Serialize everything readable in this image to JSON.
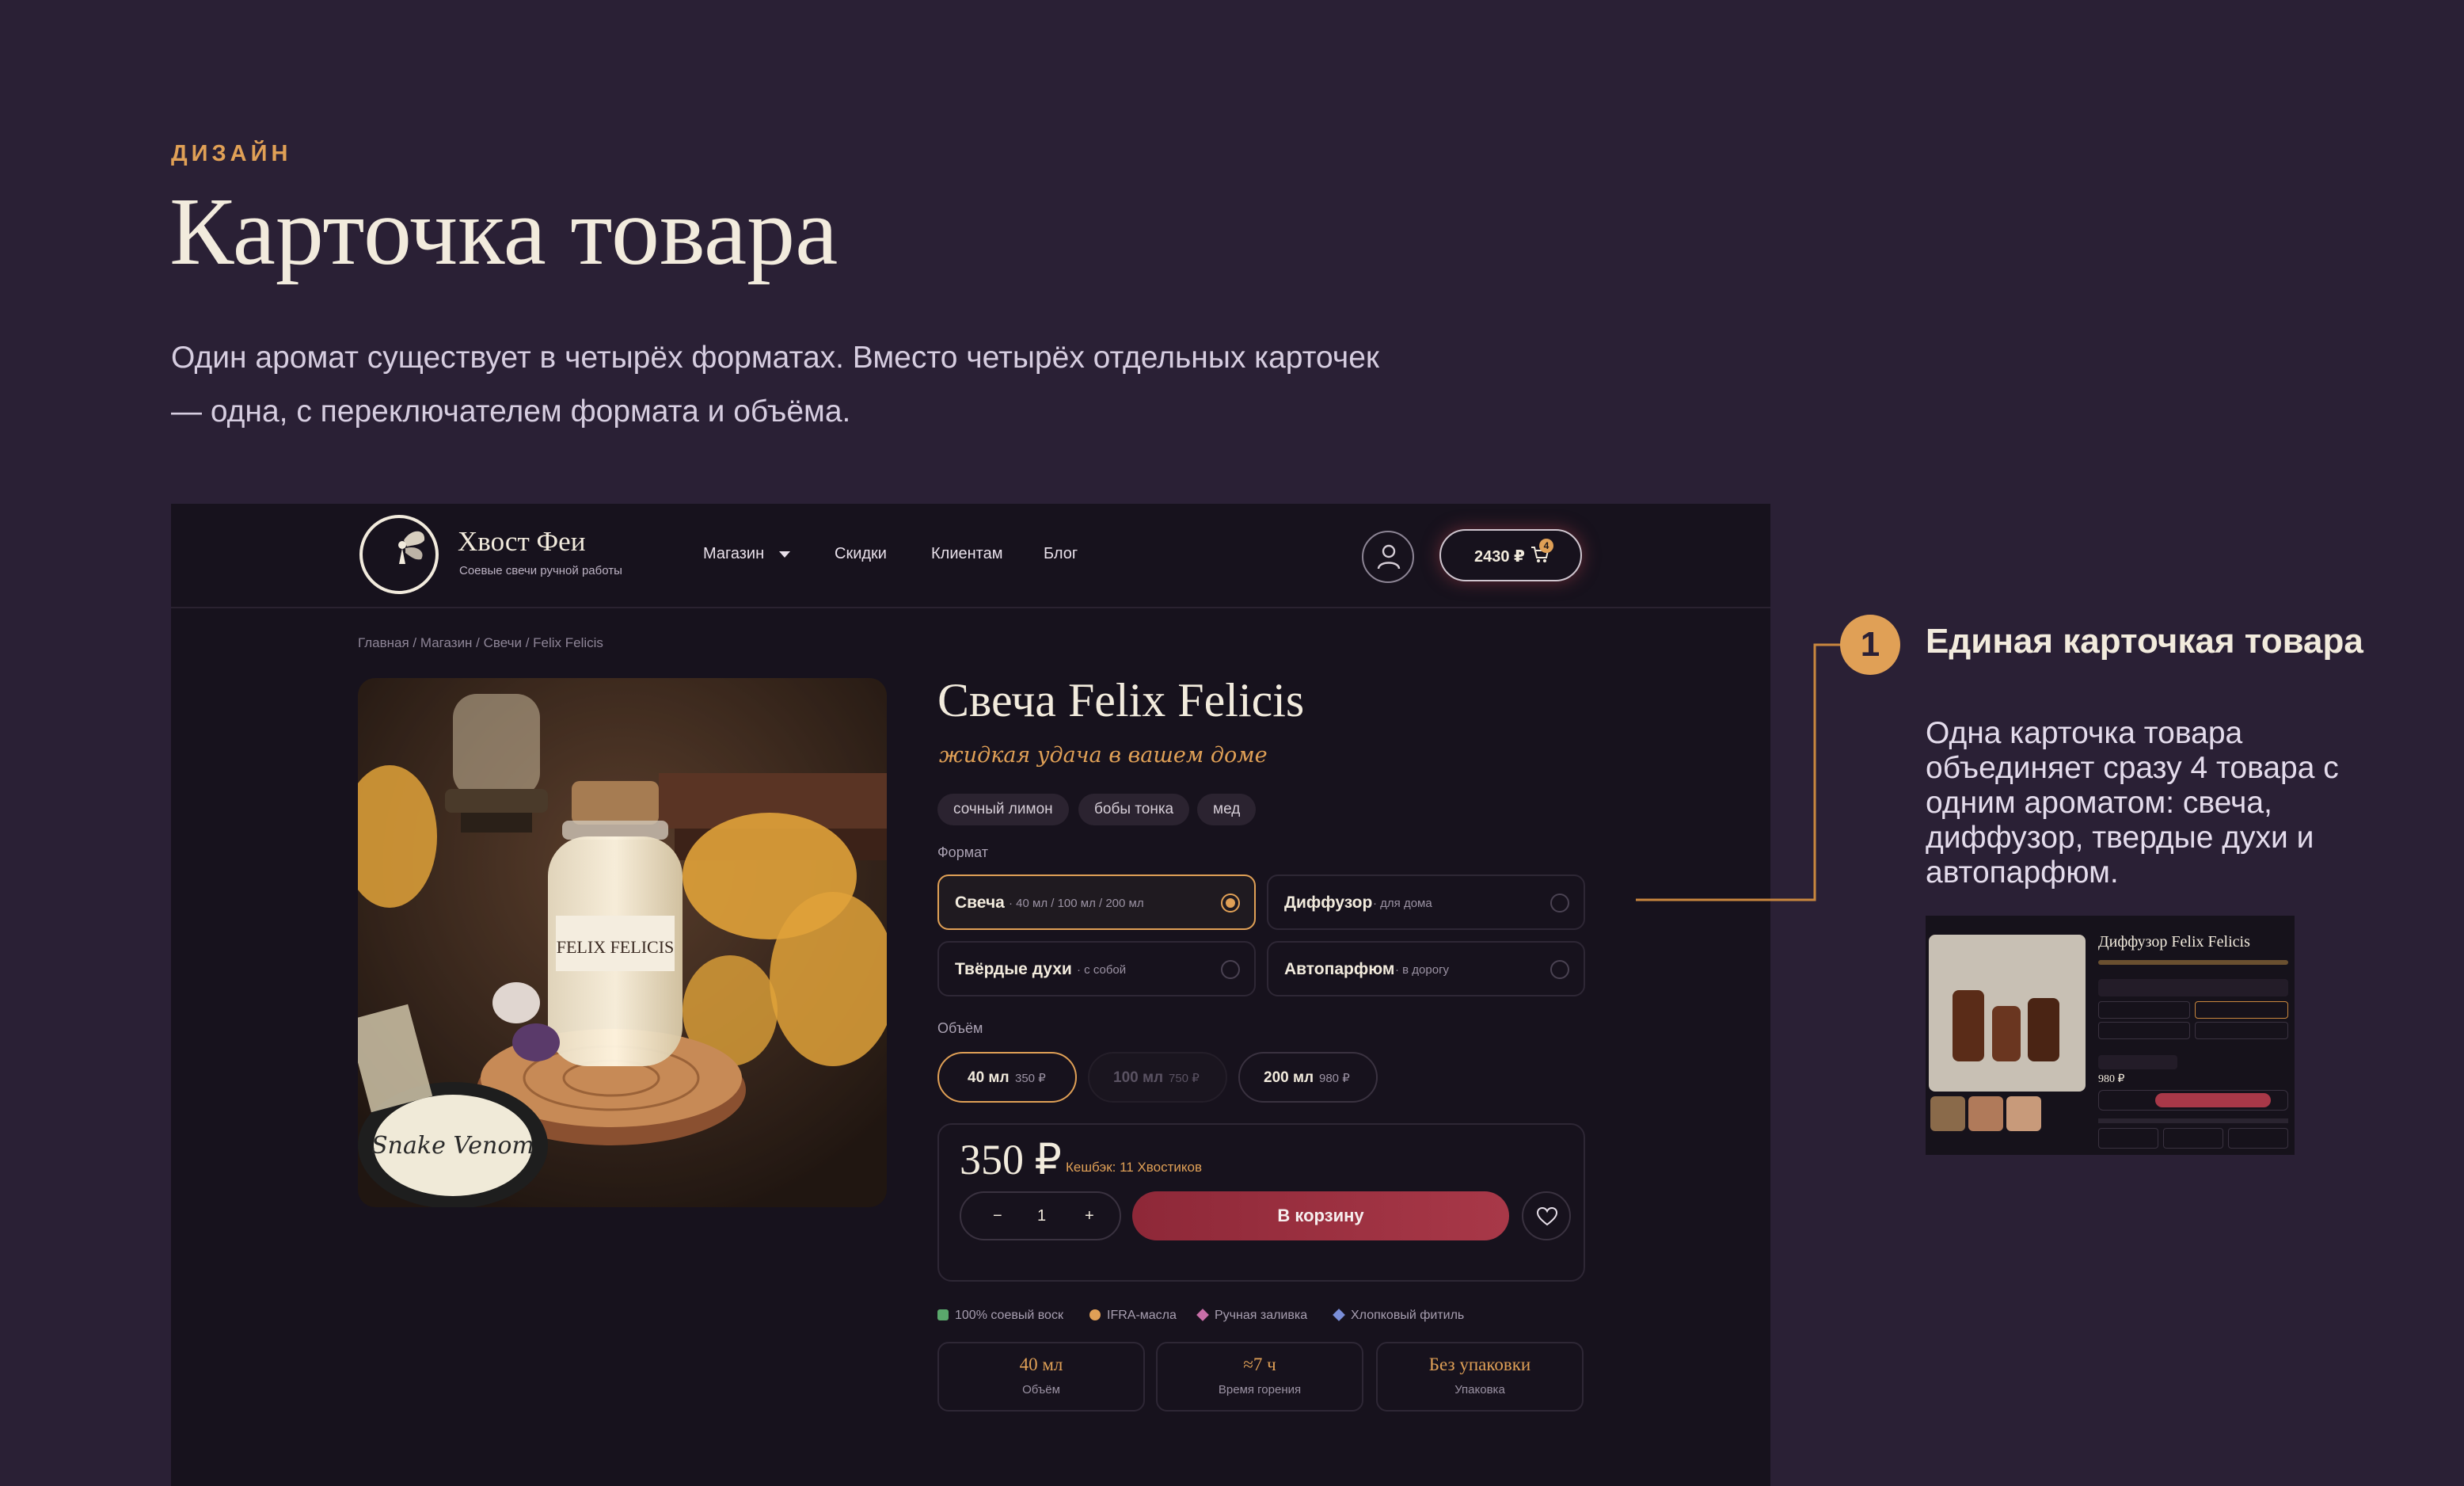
{
  "intro": {
    "kicker": "ДИЗАЙН",
    "title": "Карточка товара",
    "text": "Один аромат существует в четырёх форматах. Вместо четырёх отдельных карточек — одна, с переключателем формата и объёма."
  },
  "colors": {
    "background": "#2a2035",
    "accent": "#e0a056",
    "cta": "#a83848",
    "mockup_bg": "#17121d"
  },
  "site": {
    "logo_name": "Хвост Феи",
    "logo_tagline": "Соевые свечи ручной работы",
    "logo_icon": "fairy-moon-icon",
    "nav": [
      "Магазин",
      "Скидки",
      "Клиентам",
      "Блог"
    ],
    "user_icon": "user-icon",
    "cart_total": "2430 ₽",
    "cart_icon": "cart-icon",
    "cart_count": "4"
  },
  "breadcrumbs": "Главная / Магазин / Свечи / Felix Felicis",
  "product": {
    "title": "Свеча Felix Felicis",
    "subtitle": "жидкая удача в вашем доме",
    "tags": [
      "сочный лимон",
      "бобы тонка",
      "мед"
    ],
    "format_label": "Формат",
    "formats": [
      {
        "name": "Свеча",
        "sub": "· 40 мл / 100 мл / 200 мл",
        "selected": true
      },
      {
        "name": "Диффузор",
        "sub": "· для дома",
        "selected": false
      },
      {
        "name": "Твёрдые духи",
        "sub": "· с собой",
        "selected": false
      },
      {
        "name": "Автопарфюм",
        "sub": "· в дорогу",
        "selected": false
      }
    ],
    "volume_label": "Объём",
    "volumes": [
      {
        "name": "40 мл",
        "price": "350 ₽",
        "state": "selected"
      },
      {
        "name": "100 мл",
        "price": "750 ₽",
        "state": "disabled"
      },
      {
        "name": "200 мл",
        "price": "980 ₽",
        "state": "default"
      }
    ],
    "price": "350 ₽",
    "cashback": "Кешбэк: 11 Хвостиков",
    "qty_minus": "−",
    "qty_value": "1",
    "qty_plus": "+",
    "add_to_cart": "В корзину",
    "wishlist_icon": "heart-icon",
    "features": [
      "100% соевый воск",
      "IFRA-масла",
      "Ручная заливка",
      "Хлопковый фитиль"
    ],
    "specs": [
      {
        "value": "40 мл",
        "label": "Объём"
      },
      {
        "value": "≈7 ч",
        "label": "Время горения"
      },
      {
        "value": "Без упаковки",
        "label": "Упаковка"
      }
    ]
  },
  "photo": {
    "jar_label": "FELIX FELICIS",
    "sticker_text": "Snake Venom"
  },
  "note": {
    "number": "1",
    "title": "Единая карточкая товара",
    "text": "Одна карточка товара объединяет сразу 4 товара с одним ароматом: свеча, диффузор, твердые духи и автопарфюм."
  },
  "thumb": {
    "title": "Диффузор Felix Felicis",
    "price": "980 ₽"
  }
}
